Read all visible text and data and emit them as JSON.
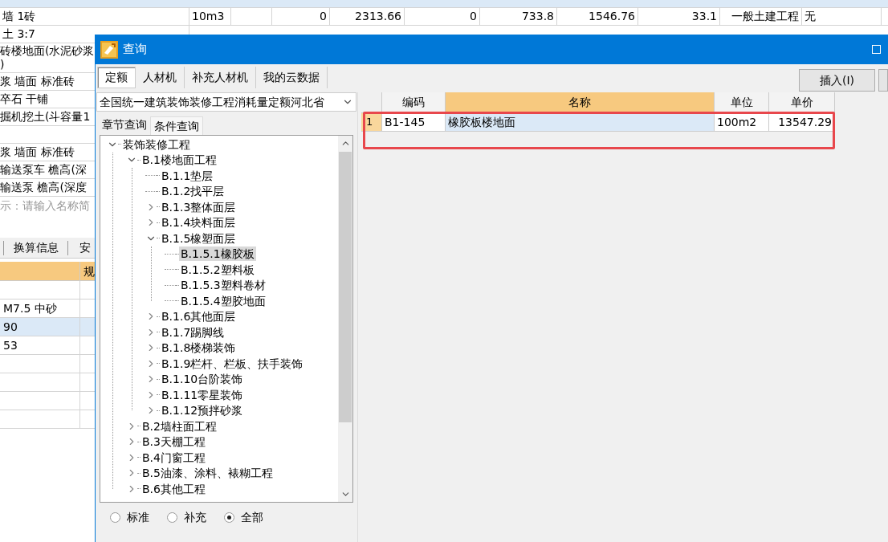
{
  "background_table": {
    "rows": [
      {
        "selected": true
      },
      {
        "selected": false,
        "cells": [
          "墙 1砖",
          "10m3",
          null,
          "0",
          "2313.66",
          "0",
          "733.8",
          "1546.76",
          "33.1",
          "一般土建工程",
          "无"
        ]
      },
      {
        "selected": false,
        "cells": [
          "土 3:7"
        ]
      }
    ]
  },
  "background_list": [
    {
      "kind": "text",
      "lines": [
        "砖楼地面(水泥砂浆",
        ")"
      ]
    },
    {
      "kind": "text",
      "lines": [
        "浆 墙面 标准砖"
      ]
    },
    {
      "kind": "text",
      "lines": [
        "卒石 干铺"
      ]
    },
    {
      "kind": "text",
      "lines": [
        "掘机挖土(斗容量1"
      ]
    },
    {
      "kind": "blank"
    },
    {
      "kind": "text",
      "lines": [
        "浆 墙面 标准砖"
      ]
    },
    {
      "kind": "text",
      "lines": [
        "输送泵车 檐高(深"
      ]
    },
    {
      "kind": "text",
      "lines": [
        "输送泵 檐高(深度"
      ]
    },
    {
      "kind": "hint",
      "lines": [
        "示：请输入名称简"
      ]
    }
  ],
  "background_lower": {
    "tabs": [
      "换算信息",
      "安"
    ],
    "header": "规",
    "rows": [
      {
        "selected": false
      },
      {
        "selected": false,
        "text": "M7.5 中砂"
      },
      {
        "selected": true,
        "text": "90"
      },
      {
        "selected": false,
        "text": "53"
      },
      {
        "selected": false
      },
      {
        "selected": false
      },
      {
        "selected": false
      },
      {
        "selected": false
      }
    ]
  },
  "dialog": {
    "title": "查询",
    "tabs": [
      {
        "label": "定额",
        "selected": true
      },
      {
        "label": "人材机",
        "selected": false
      },
      {
        "label": "补充人材机",
        "selected": false
      },
      {
        "label": "我的云数据",
        "selected": false
      }
    ],
    "insert_button": "插入(I)",
    "library": "全国统一建筑装饰装修工程消耗量定额河北省",
    "search_tabs": [
      {
        "label": "章节查询",
        "selected": true
      },
      {
        "label": "条件查询",
        "selected": false
      }
    ],
    "tree": [
      {
        "label": "装饰装修工程",
        "expanded": true,
        "selected": false,
        "children": [
          {
            "label": "B.1楼地面工程",
            "expanded": true,
            "selected": false,
            "children": [
              {
                "label": "B.1.1垫层",
                "selected": false
              },
              {
                "label": "B.1.2找平层",
                "selected": false
              },
              {
                "label": "B.1.3整体面层",
                "expanded": false,
                "selected": false
              },
              {
                "label": "B.1.4块料面层",
                "expanded": false,
                "selected": false
              },
              {
                "label": "B.1.5橡塑面层",
                "expanded": true,
                "selected": false,
                "children": [
                  {
                    "label": "B.1.5.1橡胶板",
                    "selected": true
                  },
                  {
                    "label": "B.1.5.2塑料板",
                    "selected": false
                  },
                  {
                    "label": "B.1.5.3塑料卷材",
                    "selected": false
                  },
                  {
                    "label": "B.1.5.4塑胶地面",
                    "selected": false
                  }
                ]
              },
              {
                "label": "B.1.6其他面层",
                "expanded": false,
                "selected": false
              },
              {
                "label": "B.1.7踢脚线",
                "expanded": false,
                "selected": false
              },
              {
                "label": "B.1.8楼梯装饰",
                "expanded": false,
                "selected": false
              },
              {
                "label": "B.1.9栏杆、栏板、扶手装饰",
                "expanded": false,
                "selected": false
              },
              {
                "label": "B.1.10台阶装饰",
                "expanded": false,
                "selected": false
              },
              {
                "label": "B.1.11零星装饰",
                "expanded": false,
                "selected": false
              },
              {
                "label": "B.1.12预拌砂浆",
                "expanded": false,
                "selected": false
              }
            ]
          },
          {
            "label": "B.2墙柱面工程",
            "expanded": false,
            "selected": false
          },
          {
            "label": "B.3天棚工程",
            "expanded": false,
            "selected": false
          },
          {
            "label": "B.4门窗工程",
            "expanded": false,
            "selected": false
          },
          {
            "label": "B.5油漆、涂料、裱糊工程",
            "expanded": false,
            "selected": false
          },
          {
            "label": "B.6其他工程",
            "expanded": false,
            "selected": false
          }
        ]
      }
    ],
    "filters": [
      {
        "label": "标准",
        "selected": false
      },
      {
        "label": "补充",
        "selected": false
      },
      {
        "label": "全部",
        "selected": true
      }
    ],
    "results": {
      "columns": [
        {
          "label": "编码",
          "highlighted": false
        },
        {
          "label": "名称",
          "highlighted": true
        },
        {
          "label": "单位",
          "highlighted": false
        },
        {
          "label": "单价",
          "highlighted": false
        }
      ],
      "rows": [
        {
          "number": "1",
          "selected": true,
          "cells": [
            "B1-145",
            "橡胶板楼地面",
            "100m2",
            "13547.29"
          ]
        }
      ]
    }
  }
}
